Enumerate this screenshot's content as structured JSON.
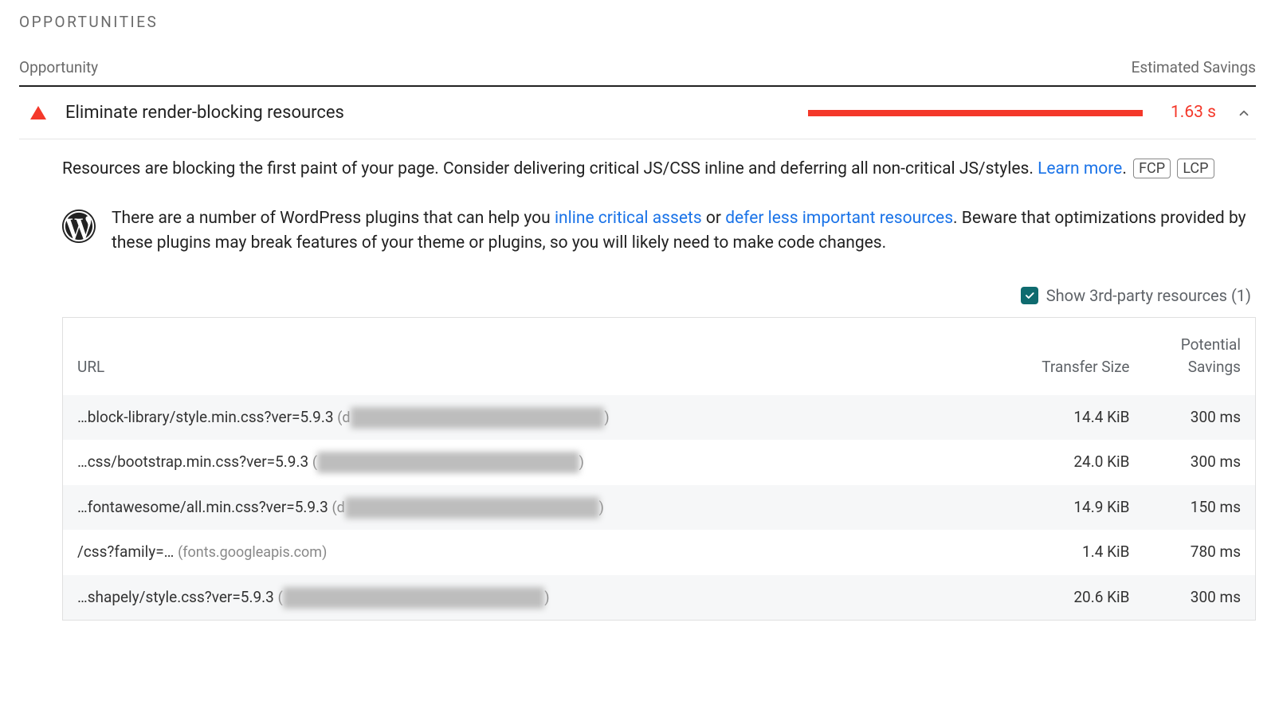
{
  "section_heading": "Opportunities",
  "header": {
    "left": "Opportunity",
    "right": "Estimated Savings"
  },
  "audit": {
    "title": "Eliminate render-blocking resources",
    "savings": "1.63 s"
  },
  "description": {
    "text_before_link": "Resources are blocking the first paint of your page. Consider delivering critical JS/CSS inline and deferring all non-critical JS/styles. ",
    "link_text": "Learn more",
    "text_after_link": ". ",
    "badge1": "FCP",
    "badge2": "LCP"
  },
  "wp_hint": {
    "part1": "There are a number of WordPress plugins that can help you ",
    "link1": "inline critical assets",
    "mid1": " or ",
    "link2": "defer less important resources",
    "part2": ". Beware that optimizations provided by these plugins may break features of your theme or plugins, so you will likely need to make code changes."
  },
  "third_party": {
    "label": "Show 3rd-party resources (1)"
  },
  "table": {
    "col_url": "URL",
    "col_size": "Transfer Size",
    "col_savings": "Potential Savings",
    "rows": [
      {
        "url": "…block-library/style.min.css?ver=5.9.3",
        "domain_prefix": "(d",
        "domain_hidden": "emo-website-8346-330redhostapp.com",
        "domain_suffix": ")",
        "size": "14.4 KiB",
        "savings": "300 ms"
      },
      {
        "url": "…css/bootstrap.min.css?ver=5.9.3",
        "domain_prefix": "(",
        "domain_hidden": "dema-website-8346-330redhostapp.com",
        "domain_suffix": ")",
        "size": "24.0 KiB",
        "savings": "300 ms"
      },
      {
        "url": "…fontawesome/all.min.css?ver=5.9.3",
        "domain_prefix": "(d",
        "domain_hidden": "emo-website-8346-330redhostapp.com",
        "domain_suffix": ")",
        "size": "14.9 KiB",
        "savings": "150 ms"
      },
      {
        "url": "/css?family=…",
        "domain_prefix": "(fonts.googleapis.com)",
        "domain_hidden": "",
        "domain_suffix": "",
        "size": "1.4 KiB",
        "savings": "780 ms"
      },
      {
        "url": "…shapely/style.css?ver=5.9.3",
        "domain_prefix": "(",
        "domain_hidden": "dema-website-8041-330redhostapp.com",
        "domain_suffix": ")",
        "size": "20.6 KiB",
        "savings": "300 ms"
      }
    ]
  }
}
